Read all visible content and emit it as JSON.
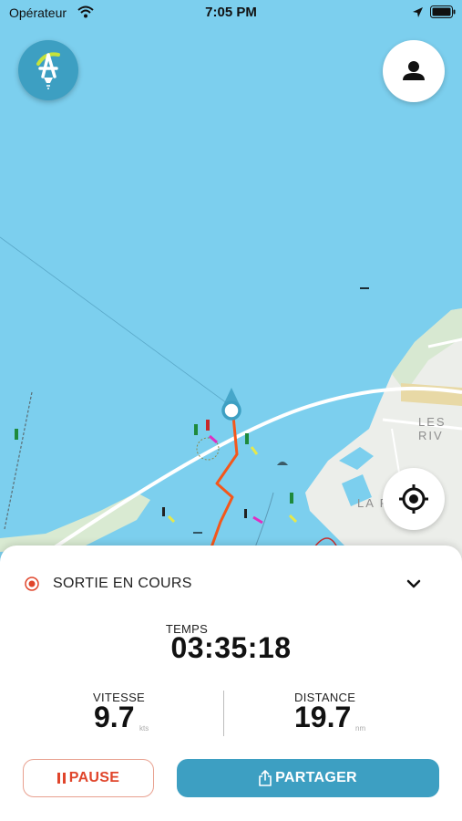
{
  "status_bar": {
    "carrier": "Opérateur",
    "time": "7:05 PM",
    "icons": [
      "wifi-icon",
      "location-arrow-icon",
      "battery-icon"
    ]
  },
  "map": {
    "labels": [
      "LES RIV",
      "LA P"
    ],
    "buttons": [
      "logo-button",
      "profile-button",
      "locate-button"
    ],
    "colors": {
      "water": "#7ccfee",
      "land": "#eceeea",
      "track": "#f4571b",
      "accent": "#3d9fc2"
    }
  },
  "session": {
    "title": "SORTIE EN COURS",
    "time": {
      "label": "TEMPS",
      "value": "03:35:18"
    },
    "speed": {
      "label": "VITESSE",
      "value": "9.7",
      "unit": "kts"
    },
    "distance": {
      "label": "DISTANCE",
      "value": "19.7",
      "unit": "nm"
    },
    "actions": {
      "pause": "PAUSE",
      "share": "PARTAGER"
    },
    "colors": {
      "record": "#e0452b",
      "pause": "#e0452b",
      "share": "#3d9fc2"
    }
  }
}
